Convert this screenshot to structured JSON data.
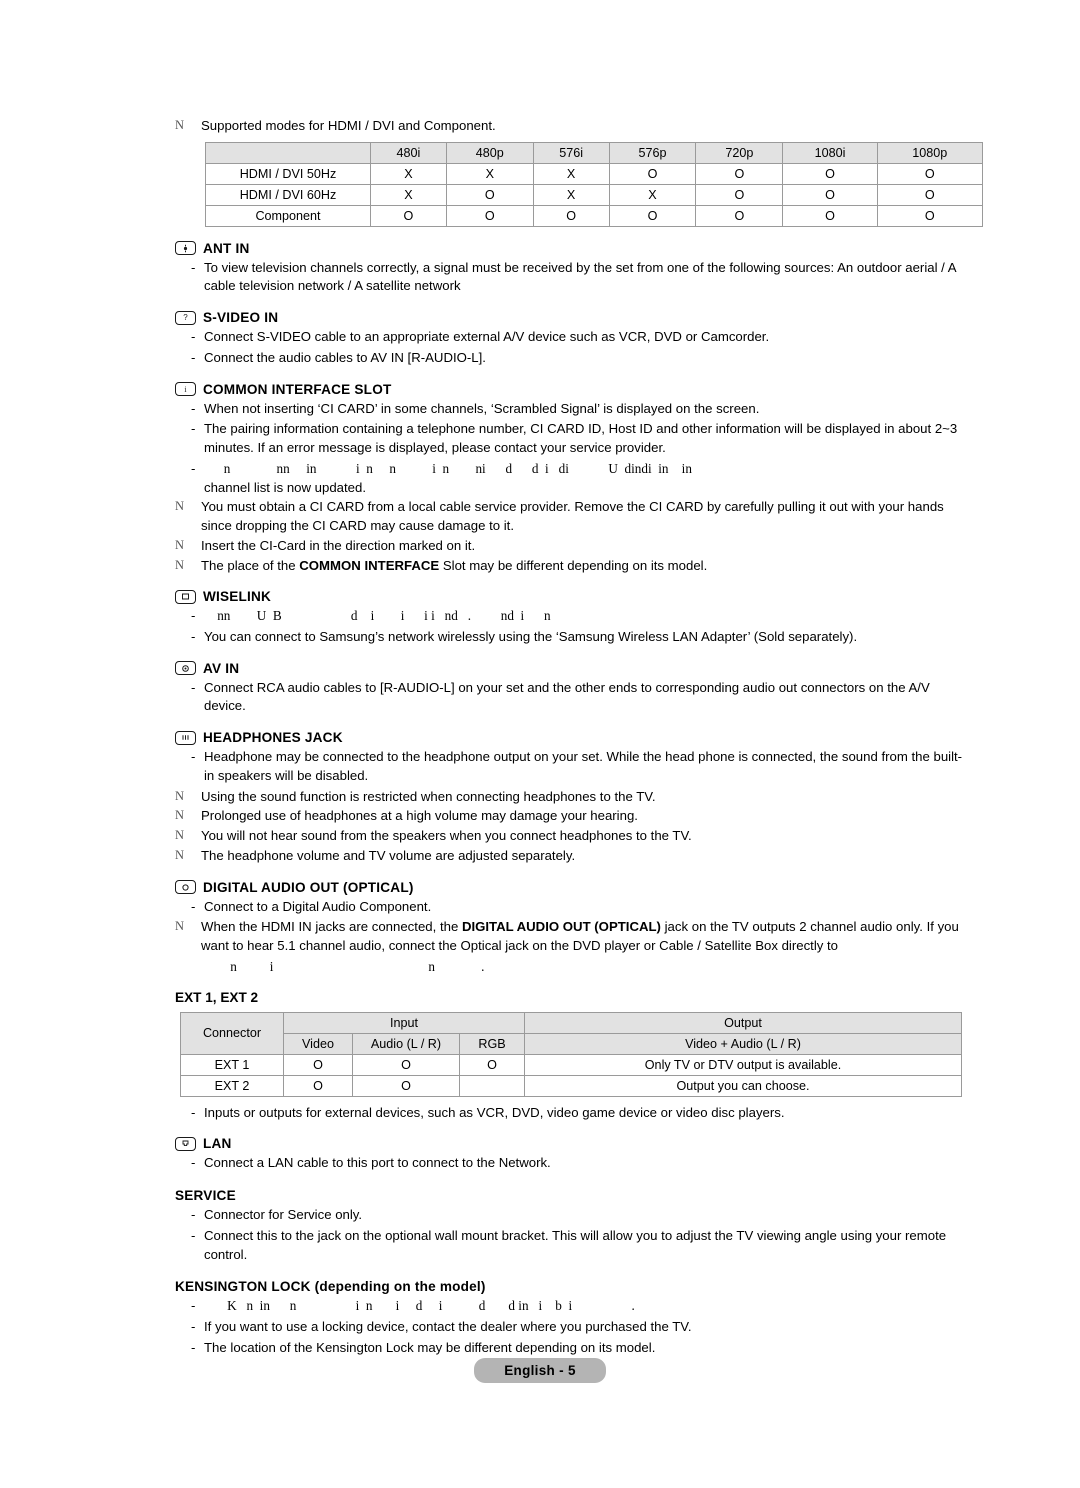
{
  "document": {
    "footer_label": "English - 5"
  },
  "modes_note": {
    "mark": "N",
    "text": "Supported modes for HDMI / DVI and Component."
  },
  "modes_table": {
    "corner": "",
    "columns": [
      "480i",
      "480p",
      "576i",
      "576p",
      "720p",
      "1080i",
      "1080p"
    ],
    "rows": [
      {
        "label": "HDMI / DVI 50Hz",
        "values": [
          "X",
          "X",
          "X",
          "O",
          "O",
          "O",
          "O"
        ]
      },
      {
        "label": "HDMI / DVI 60Hz",
        "values": [
          "X",
          "O",
          "X",
          "X",
          "O",
          "O",
          "O"
        ]
      },
      {
        "label": "Component",
        "values": [
          "O",
          "O",
          "O",
          "O",
          "O",
          "O",
          "O"
        ]
      }
    ]
  },
  "sections": {
    "ant_in": {
      "badge_icon": "ant-connector-icon",
      "title": "ANT IN",
      "bullets": [
        "To view television channels correctly, a signal must be received by the set from one of the following sources: An outdoor aerial / A cable television network / A satellite network"
      ]
    },
    "s_video_in": {
      "badge_icon": "s-video-connector-icon",
      "title": "S-VIDEO IN",
      "bullets": [
        "Connect S-VIDEO cable to an appropriate external A/V device such as VCR, DVD or Camcorder.",
        "Connect the audio cables to AV IN [R-AUDIO-L]."
      ]
    },
    "common_interface_slot": {
      "badge_icon": "common-interface-connector-icon",
      "title": "COMMON INTERFACE SLOT",
      "bullets": [
        "When not inserting ‘CI CARD’ in some channels, ‘Scrambled Signal’ is displayed on the screen.",
        "The pairing information containing a telephone number, CI CARD ID, Host ID and other information will be displayed in about 2~3 minutes. If an error message is displayed, please contact your service provider."
      ],
      "degraded_bullet_fragments": "      n              nn     in            i  n     n           i  n        ni      d      d  i   di            U  dindi  in    in",
      "degraded_bullet_continuation": "channel list is now updated.",
      "notes": [
        {
          "mark": "N",
          "text": "You must obtain a CI CARD from a local cable service provider. Remove the CI CARD by carefully pulling it out with your hands since dropping the CI CARD may cause damage to it."
        },
        {
          "mark": "N",
          "text": "Insert the CI-Card in the direction marked on it."
        },
        {
          "mark": "N",
          "text_pre": "The place of the ",
          "text_bold": "COMMON INTERFACE",
          "text_post": " Slot may be different depending on its model."
        }
      ]
    },
    "wiselink": {
      "badge_icon": "usb-connector-icon",
      "title": "WISELINK",
      "degraded_bullet_fragments": "    nn        U  B                     d    i        i      i i   nd   .         nd  i      n",
      "bullets": [
        "You can connect to Samsung’s network wirelessly using the ‘Samsung Wireless LAN Adapter’ (Sold separately)."
      ]
    },
    "av_in": {
      "badge_icon": "av-connector-icon",
      "title": "AV IN",
      "bullets": [
        "Connect RCA audio cables to [R-AUDIO-L] on your set and the other ends to corresponding audio out connectors on the A/V device."
      ]
    },
    "headphones_jack": {
      "badge_icon": "headphones-connector-icon",
      "title": "HEADPHONES JACK",
      "bullets": [
        "Headphone may be connected to the headphone output on your set. While the head phone is connected, the sound from the built-in speakers will be disabled."
      ],
      "notes": [
        {
          "mark": "N",
          "text": "Using the sound function is restricted when connecting headphones to the TV."
        },
        {
          "mark": "N",
          "text": "Prolonged use of headphones at a high volume may damage your hearing."
        },
        {
          "mark": "N",
          "text": "You will not hear sound from the speakers when you connect headphones to the TV."
        },
        {
          "mark": "N",
          "text": "The headphone volume and TV volume are adjusted separately."
        }
      ]
    },
    "digital_audio_out": {
      "badge_icon": "optical-connector-icon",
      "title": "DIGITAL AUDIO OUT (OPTICAL)",
      "bullets": [
        "Connect to a Digital Audio Component."
      ],
      "note": {
        "mark": "N",
        "text_pre": "When the HDMI IN jacks are connected, the ",
        "text_bold": "DIGITAL AUDIO OUT (OPTICAL)",
        "text_post": " jack on the TV outputs 2 channel audio only. If you want to hear 5.1 channel audio, connect the Optical jack on the DVD player or Cable / Satellite Box directly to"
      },
      "degraded_note_fragments": "    n          i                                               n              ."
    },
    "ext": {
      "title": "EXT 1, EXT 2",
      "bullets": [
        "Inputs or outputs for external devices, such as VCR, DVD, video game device or video disc players."
      ]
    },
    "lan": {
      "badge_icon": "lan-connector-icon",
      "title": "LAN",
      "bullets": [
        "Connect a LAN cable to this port to connect to the Network."
      ]
    },
    "service": {
      "title": "SERVICE",
      "bullets": [
        "Connector for Service only.",
        "Connect this to the jack on the optional wall mount bracket. This will allow you to adjust the TV viewing angle using your remote control."
      ]
    },
    "kensington_lock": {
      "title": "KENSINGTON LOCK (depending on the model)",
      "degraded_bullet_fragments": "       K   n  in      n                  i  n       i     d     i           d       d in   i    b  i                  .",
      "bullets": [
        "If you want to use a locking device, contact the dealer where you purchased the TV.",
        "The location of the Kensington Lock may be different depending on its model."
      ]
    }
  },
  "ext_table": {
    "connector_header": "Connector",
    "input_header": "Input",
    "output_header": "Output",
    "sub_headers": [
      "Video",
      "Audio (L / R)",
      "RGB"
    ],
    "output_sub_header": "Video + Audio (L / R)",
    "rows": [
      {
        "connector": "EXT 1",
        "video": "O",
        "audio": "O",
        "rgb": "O",
        "output": "Only TV or DTV output is available."
      },
      {
        "connector": "EXT 2",
        "video": "O",
        "audio": "O",
        "rgb": "",
        "output": "Output you can choose."
      }
    ]
  }
}
